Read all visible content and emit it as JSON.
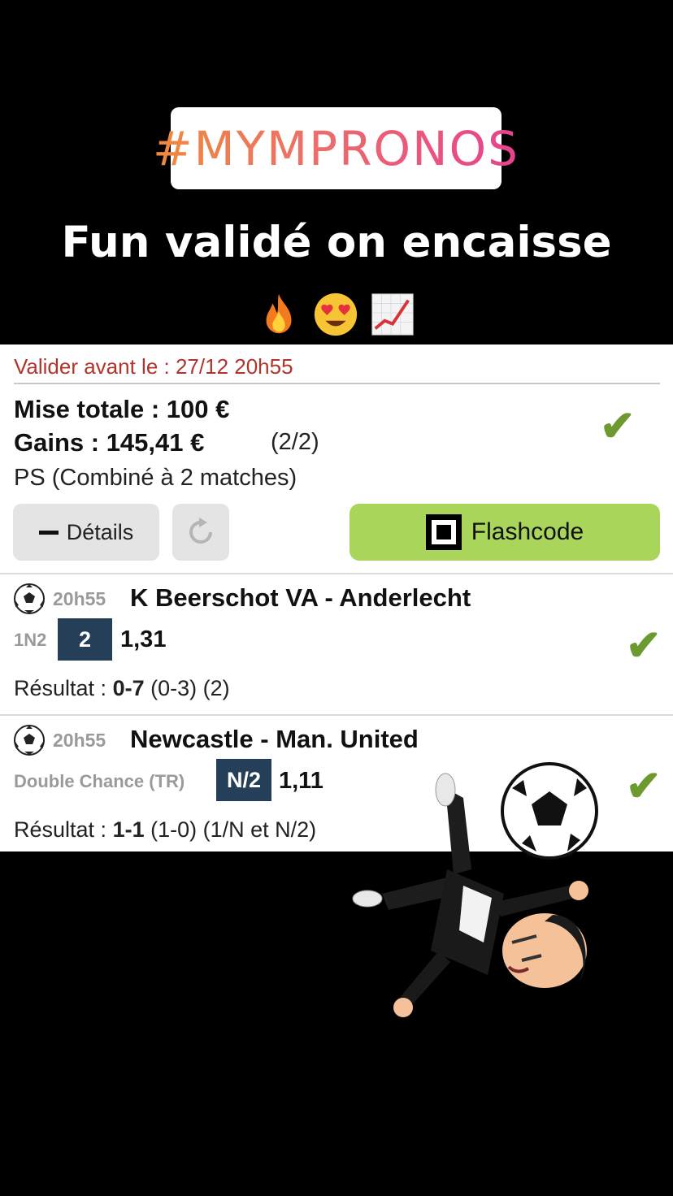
{
  "story": {
    "hashtag": "#MYMPRONOS",
    "caption": "Fun validé on encaisse",
    "emojis": [
      "fire-emoji",
      "heart-eyes-emoji",
      "chart-increasing-emoji"
    ]
  },
  "bet": {
    "deadline": "Valider avant le : 27/12 20h55",
    "stake": "Mise totale : 100 €",
    "gains": "Gains : 145,41 €",
    "count": "(2/2)",
    "type": "PS (Combiné à 2 matches)",
    "status_icon": "✔",
    "details_label": "Détails",
    "flashcode_label": "Flashcode"
  },
  "matches": [
    {
      "time": "20h55",
      "teams": "K Beerschot VA - Anderlecht",
      "market": "1N2",
      "pick": "2",
      "odds": "1,31",
      "result_label": "Résultat : ",
      "score": "0-7",
      "detail": " (0-3) (2)",
      "status_icon": "✔"
    },
    {
      "time": "20h55",
      "teams": "Newcastle - Man. United",
      "market": "Double Chance (TR)",
      "pick": "N/2",
      "odds": "1,11",
      "result_label": "Résultat : ",
      "score": "1-1",
      "detail": " (1-0) (1/N et N/2)",
      "status_icon": "✔"
    }
  ],
  "colors": {
    "deadline": "#b1342c",
    "check": "#6c9a2e",
    "flashcode_bg": "#a9d55a",
    "pick_bg": "#263f59"
  }
}
